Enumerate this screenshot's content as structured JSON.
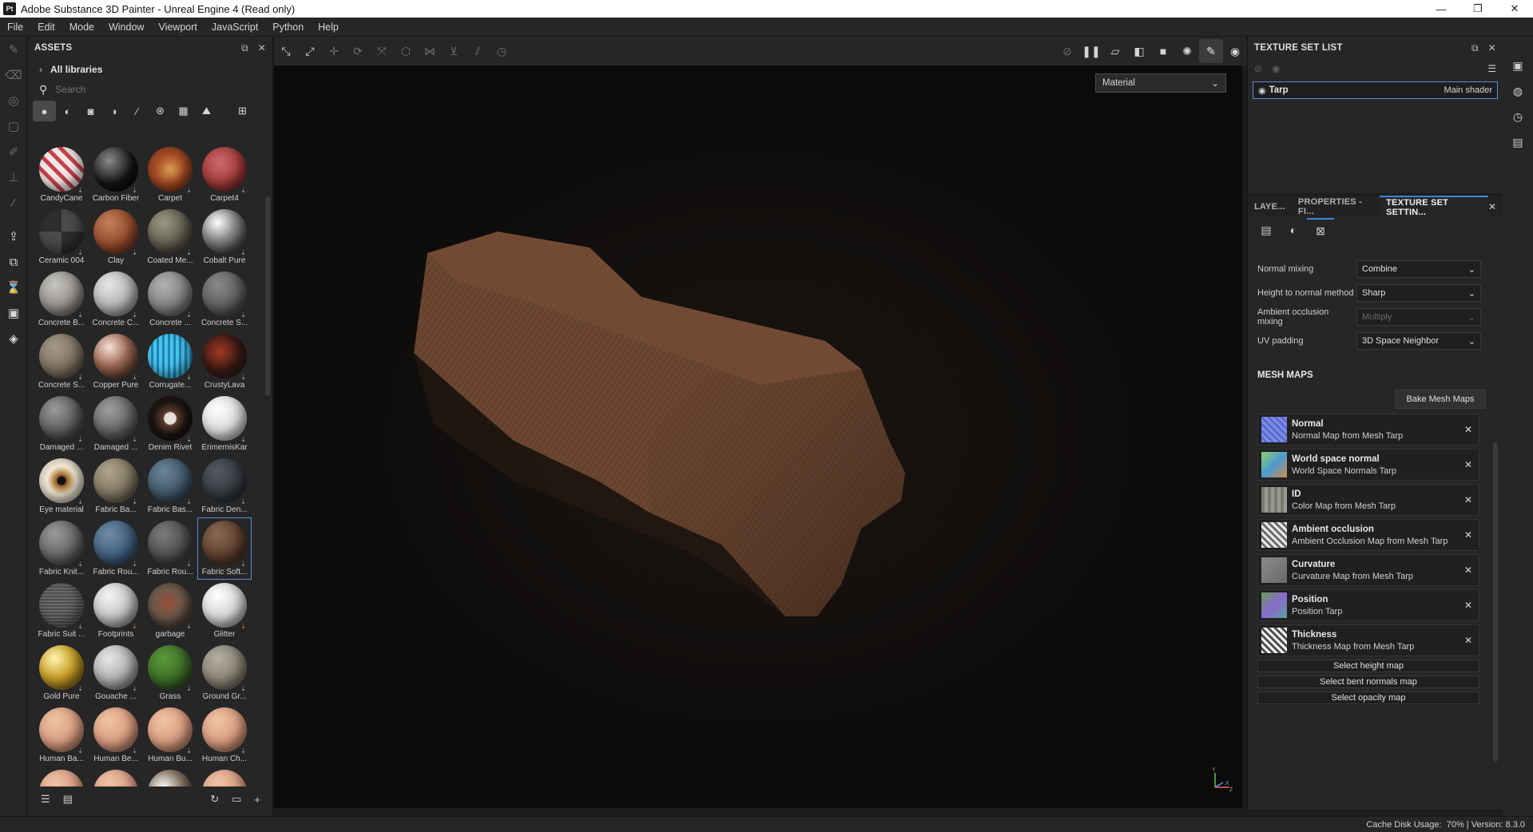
{
  "window": {
    "app_icon": "Pt",
    "title": "Adobe Substance 3D Painter - Unreal Engine 4 (Read only)",
    "controls": [
      "—",
      "❐",
      "✕"
    ]
  },
  "menu": [
    "File",
    "Edit",
    "Mode",
    "Window",
    "Viewport",
    "JavaScript",
    "Python",
    "Help"
  ],
  "assets_panel": {
    "title": "ASSETS",
    "all_libraries": "All libraries",
    "search_placeholder": "Search",
    "filters": [
      "sphere-material-icon",
      "smart-material-icon",
      "mask-icon",
      "filter-icon",
      "brush-icon",
      "particle-icon",
      "texture-icon",
      "environment-icon",
      "grid-view-icon"
    ],
    "items": [
      {
        "label": "CandyCane"
      },
      {
        "label": "Carbon Fiber"
      },
      {
        "label": "Carpet"
      },
      {
        "label": "Carpet4"
      },
      {
        "label": "Ceramic 004"
      },
      {
        "label": "Clay"
      },
      {
        "label": "Coated Me..."
      },
      {
        "label": "Cobalt Pure"
      },
      {
        "label": "Concrete B..."
      },
      {
        "label": "Concrete C..."
      },
      {
        "label": "Concrete ..."
      },
      {
        "label": "Concrete S..."
      },
      {
        "label": "Concrete S..."
      },
      {
        "label": "Copper Pure"
      },
      {
        "label": "Corrugate..."
      },
      {
        "label": "CrustyLava"
      },
      {
        "label": "Damaged ..."
      },
      {
        "label": "Damaged ..."
      },
      {
        "label": "Denim Rivet"
      },
      {
        "label": "ErimemisKar"
      },
      {
        "label": "Eye material"
      },
      {
        "label": "Fabric Ba..."
      },
      {
        "label": "Fabric Bas..."
      },
      {
        "label": "Fabric Den..."
      },
      {
        "label": "Fabric Knit..."
      },
      {
        "label": "Fabric Rou..."
      },
      {
        "label": "Fabric Rou..."
      },
      {
        "label": "Fabric Soft..."
      },
      {
        "label": "Fabric Suit ..."
      },
      {
        "label": "Footprints"
      },
      {
        "label": "garbage"
      },
      {
        "label": "Glitter"
      },
      {
        "label": "Gold Pure"
      },
      {
        "label": "Gouache ..."
      },
      {
        "label": "Grass"
      },
      {
        "label": "Ground Gr..."
      },
      {
        "label": "Human Ba..."
      },
      {
        "label": "Human Be..."
      },
      {
        "label": "Human Bu..."
      },
      {
        "label": "Human Ch..."
      },
      {
        "label": ""
      },
      {
        "label": ""
      },
      {
        "label": ""
      },
      {
        "label": ""
      }
    ]
  },
  "viewport": {
    "mode_select": "Material",
    "axis": {
      "y": "Y",
      "x": "X",
      "z": "Z"
    }
  },
  "texture_set_list": {
    "title": "TEXTURE SET LIST",
    "row": {
      "name": "Tarp",
      "shader": "Main shader"
    }
  },
  "settings_panel": {
    "tabs": [
      "LAYE...",
      "PROPERTIES - FI...",
      "TEXTURE SET SETTIN..."
    ],
    "settings": [
      {
        "label": "Normal mixing",
        "value": "Combine",
        "disabled": false
      },
      {
        "label": "Height to normal method",
        "value": "Sharp",
        "disabled": false
      },
      {
        "label": "Ambient occlusion mixing",
        "value": "Multiply",
        "disabled": true
      },
      {
        "label": "UV padding",
        "value": "3D Space Neighbor",
        "disabled": false
      }
    ],
    "mesh_maps_title": "MESH MAPS",
    "bake_button": "Bake Mesh Maps",
    "mesh_maps": [
      {
        "name": "Normal",
        "desc": "Normal Map from Mesh Tarp"
      },
      {
        "name": "World space normal",
        "desc": "World Space Normals Tarp"
      },
      {
        "name": "ID",
        "desc": "Color Map from Mesh Tarp"
      },
      {
        "name": "Ambient occlusion",
        "desc": "Ambient Occlusion Map from Mesh Tarp"
      },
      {
        "name": "Curvature",
        "desc": "Curvature Map from Mesh Tarp"
      },
      {
        "name": "Position",
        "desc": "Position Tarp"
      },
      {
        "name": "Thickness",
        "desc": "Thickness Map from Mesh Tarp"
      }
    ],
    "select_buttons": [
      "Select height map",
      "Select bent normals map",
      "Select opacity map"
    ]
  },
  "status": {
    "cache_label": "Cache Disk Usage:",
    "cache_value": "70%",
    "version": "Version: 8.3.0"
  }
}
